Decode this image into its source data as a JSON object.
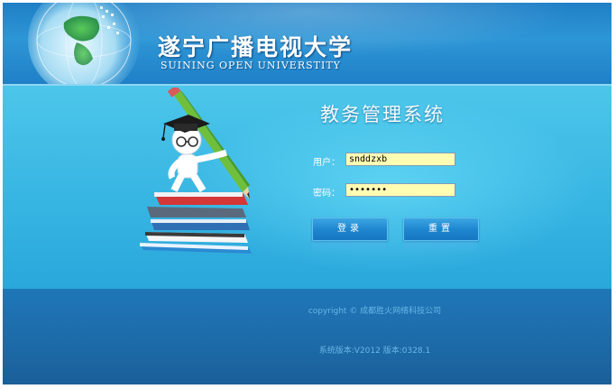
{
  "header": {
    "title_cn": "遂宁广播电视大学",
    "title_en": "SUINING OPEN UNIVERSTITY"
  },
  "login": {
    "system_title": "教务管理系统",
    "username_label": "用户：",
    "username_value": "snddzxb",
    "password_label": "密码：",
    "password_value": "•••••••",
    "login_button": "登录",
    "reset_button": "重置"
  },
  "footer": {
    "copyright": "copyright © 成都胜火网络科技公司",
    "version": "系统版本:V2012 版本:0328.1"
  },
  "colors": {
    "header_bg": "#2d96d6",
    "main_bg": "#4cc6ea",
    "footer_bg": "#1d6aa8",
    "input_bg": "#fffdb2",
    "button_bg": "#1f86cf"
  }
}
